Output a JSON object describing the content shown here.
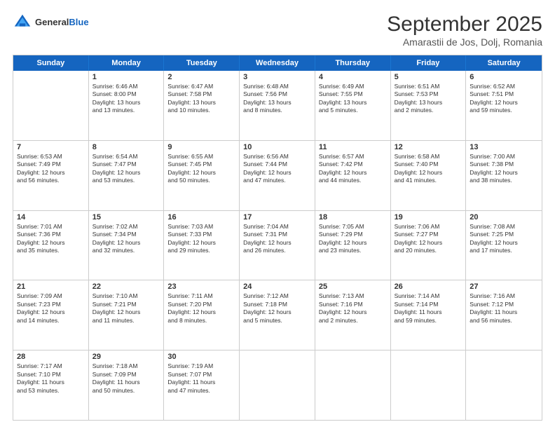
{
  "header": {
    "logo_general": "General",
    "logo_blue": "Blue",
    "month_title": "September 2025",
    "subtitle": "Amarastii de Jos, Dolj, Romania"
  },
  "days_of_week": [
    "Sunday",
    "Monday",
    "Tuesday",
    "Wednesday",
    "Thursday",
    "Friday",
    "Saturday"
  ],
  "weeks": [
    [
      {
        "day": "",
        "content": ""
      },
      {
        "day": "1",
        "content": "Sunrise: 6:46 AM\nSunset: 8:00 PM\nDaylight: 13 hours\nand 13 minutes."
      },
      {
        "day": "2",
        "content": "Sunrise: 6:47 AM\nSunset: 7:58 PM\nDaylight: 13 hours\nand 10 minutes."
      },
      {
        "day": "3",
        "content": "Sunrise: 6:48 AM\nSunset: 7:56 PM\nDaylight: 13 hours\nand 8 minutes."
      },
      {
        "day": "4",
        "content": "Sunrise: 6:49 AM\nSunset: 7:55 PM\nDaylight: 13 hours\nand 5 minutes."
      },
      {
        "day": "5",
        "content": "Sunrise: 6:51 AM\nSunset: 7:53 PM\nDaylight: 13 hours\nand 2 minutes."
      },
      {
        "day": "6",
        "content": "Sunrise: 6:52 AM\nSunset: 7:51 PM\nDaylight: 12 hours\nand 59 minutes."
      }
    ],
    [
      {
        "day": "7",
        "content": "Sunrise: 6:53 AM\nSunset: 7:49 PM\nDaylight: 12 hours\nand 56 minutes."
      },
      {
        "day": "8",
        "content": "Sunrise: 6:54 AM\nSunset: 7:47 PM\nDaylight: 12 hours\nand 53 minutes."
      },
      {
        "day": "9",
        "content": "Sunrise: 6:55 AM\nSunset: 7:45 PM\nDaylight: 12 hours\nand 50 minutes."
      },
      {
        "day": "10",
        "content": "Sunrise: 6:56 AM\nSunset: 7:44 PM\nDaylight: 12 hours\nand 47 minutes."
      },
      {
        "day": "11",
        "content": "Sunrise: 6:57 AM\nSunset: 7:42 PM\nDaylight: 12 hours\nand 44 minutes."
      },
      {
        "day": "12",
        "content": "Sunrise: 6:58 AM\nSunset: 7:40 PM\nDaylight: 12 hours\nand 41 minutes."
      },
      {
        "day": "13",
        "content": "Sunrise: 7:00 AM\nSunset: 7:38 PM\nDaylight: 12 hours\nand 38 minutes."
      }
    ],
    [
      {
        "day": "14",
        "content": "Sunrise: 7:01 AM\nSunset: 7:36 PM\nDaylight: 12 hours\nand 35 minutes."
      },
      {
        "day": "15",
        "content": "Sunrise: 7:02 AM\nSunset: 7:34 PM\nDaylight: 12 hours\nand 32 minutes."
      },
      {
        "day": "16",
        "content": "Sunrise: 7:03 AM\nSunset: 7:33 PM\nDaylight: 12 hours\nand 29 minutes."
      },
      {
        "day": "17",
        "content": "Sunrise: 7:04 AM\nSunset: 7:31 PM\nDaylight: 12 hours\nand 26 minutes."
      },
      {
        "day": "18",
        "content": "Sunrise: 7:05 AM\nSunset: 7:29 PM\nDaylight: 12 hours\nand 23 minutes."
      },
      {
        "day": "19",
        "content": "Sunrise: 7:06 AM\nSunset: 7:27 PM\nDaylight: 12 hours\nand 20 minutes."
      },
      {
        "day": "20",
        "content": "Sunrise: 7:08 AM\nSunset: 7:25 PM\nDaylight: 12 hours\nand 17 minutes."
      }
    ],
    [
      {
        "day": "21",
        "content": "Sunrise: 7:09 AM\nSunset: 7:23 PM\nDaylight: 12 hours\nand 14 minutes."
      },
      {
        "day": "22",
        "content": "Sunrise: 7:10 AM\nSunset: 7:21 PM\nDaylight: 12 hours\nand 11 minutes."
      },
      {
        "day": "23",
        "content": "Sunrise: 7:11 AM\nSunset: 7:20 PM\nDaylight: 12 hours\nand 8 minutes."
      },
      {
        "day": "24",
        "content": "Sunrise: 7:12 AM\nSunset: 7:18 PM\nDaylight: 12 hours\nand 5 minutes."
      },
      {
        "day": "25",
        "content": "Sunrise: 7:13 AM\nSunset: 7:16 PM\nDaylight: 12 hours\nand 2 minutes."
      },
      {
        "day": "26",
        "content": "Sunrise: 7:14 AM\nSunset: 7:14 PM\nDaylight: 11 hours\nand 59 minutes."
      },
      {
        "day": "27",
        "content": "Sunrise: 7:16 AM\nSunset: 7:12 PM\nDaylight: 11 hours\nand 56 minutes."
      }
    ],
    [
      {
        "day": "28",
        "content": "Sunrise: 7:17 AM\nSunset: 7:10 PM\nDaylight: 11 hours\nand 53 minutes."
      },
      {
        "day": "29",
        "content": "Sunrise: 7:18 AM\nSunset: 7:09 PM\nDaylight: 11 hours\nand 50 minutes."
      },
      {
        "day": "30",
        "content": "Sunrise: 7:19 AM\nSunset: 7:07 PM\nDaylight: 11 hours\nand 47 minutes."
      },
      {
        "day": "",
        "content": ""
      },
      {
        "day": "",
        "content": ""
      },
      {
        "day": "",
        "content": ""
      },
      {
        "day": "",
        "content": ""
      }
    ]
  ]
}
